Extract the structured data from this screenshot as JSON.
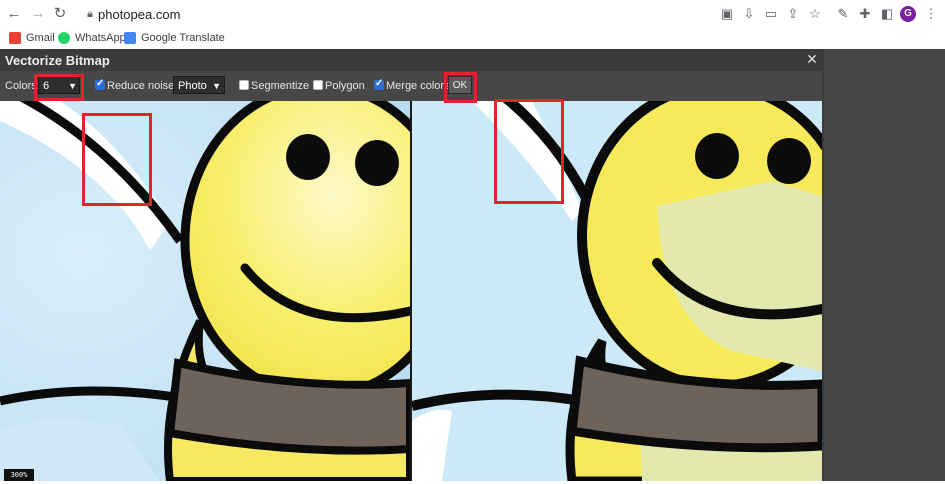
{
  "browser": {
    "url": "photopea.com",
    "avatar_letter": "G",
    "bookmarks": [
      {
        "label": "Gmail",
        "icon": "gmail-icon",
        "color": "#ea4335"
      },
      {
        "label": "WhatsApp",
        "icon": "whatsapp-icon",
        "color": "#25d366"
      },
      {
        "label": "Google Translate",
        "icon": "translate-icon",
        "color": "#4285f4"
      }
    ]
  },
  "dialog": {
    "title": "Vectorize Bitmap",
    "colors_label": "Colors:",
    "colors_value": "6",
    "reduce_noise_label": "Reduce noise",
    "reduce_noise_checked": true,
    "mode_value": "Photo",
    "segmentize_label": "Segmentize",
    "segmentize_checked": false,
    "polygon_label": "Polygon",
    "polygon_checked": false,
    "merge_colors_label": "Merge colors",
    "merge_colors_checked": true,
    "ok_label": "OK"
  },
  "zoom_label": "300%",
  "colors": {
    "sky": "#cfe7f6",
    "bee_yellow": "#f7ea5a",
    "bee_stripe": "#6e635a",
    "outline": "#0b0b0b",
    "highlight": "#e0242c"
  }
}
